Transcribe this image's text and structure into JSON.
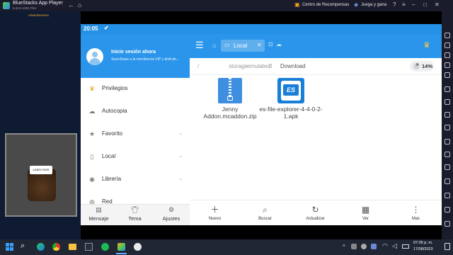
{
  "window": {
    "title": "BlueStacks App Player",
    "subtitle": "5.10.0.1001 P64",
    "rewards_label": "Centro de Recompensas",
    "play_label": "Juega y gana"
  },
  "ad": {
    "label": "Advertisement",
    "learn_more": "Learn more"
  },
  "status": {
    "time": "20:05"
  },
  "drawer": {
    "login_title": "Inicie sesión ahora",
    "login_subtitle": "Suscríbase a la membresía VIP y disfrute...",
    "items": [
      {
        "label": "Privilegios",
        "icon": "crown-icon"
      },
      {
        "label": "Autocopia",
        "icon": "cloud-icon"
      },
      {
        "label": "Favorito",
        "icon": "star-icon"
      },
      {
        "label": "Local",
        "icon": "phone-icon"
      },
      {
        "label": "Librería",
        "icon": "library-icon"
      },
      {
        "label": "Red",
        "icon": "network-icon"
      }
    ],
    "bottom": [
      "Mensaje",
      "Tema",
      "Ajustes"
    ]
  },
  "toolbar": {
    "tab_label": "Local"
  },
  "path": {
    "segments": [
      "/",
      "storage",
      "emulated",
      "0",
      "Download"
    ],
    "storage_percent": "14%"
  },
  "files": [
    {
      "name": "Jenny Addon.mcaddon.zip",
      "type": "zip"
    },
    {
      "name": "es-file-explorer-4-4-0-2-1.apk",
      "type": "apk"
    }
  ],
  "bottom_toolbar": [
    "Nuevo",
    "Buscar",
    "Actualizar",
    "Ver",
    "Mas"
  ],
  "taskbar": {
    "time": "07:05 p. m.",
    "date": "17/08/2023"
  },
  "colors": {
    "accent": "#2a95ea",
    "chrome": "#1a1b2b"
  }
}
